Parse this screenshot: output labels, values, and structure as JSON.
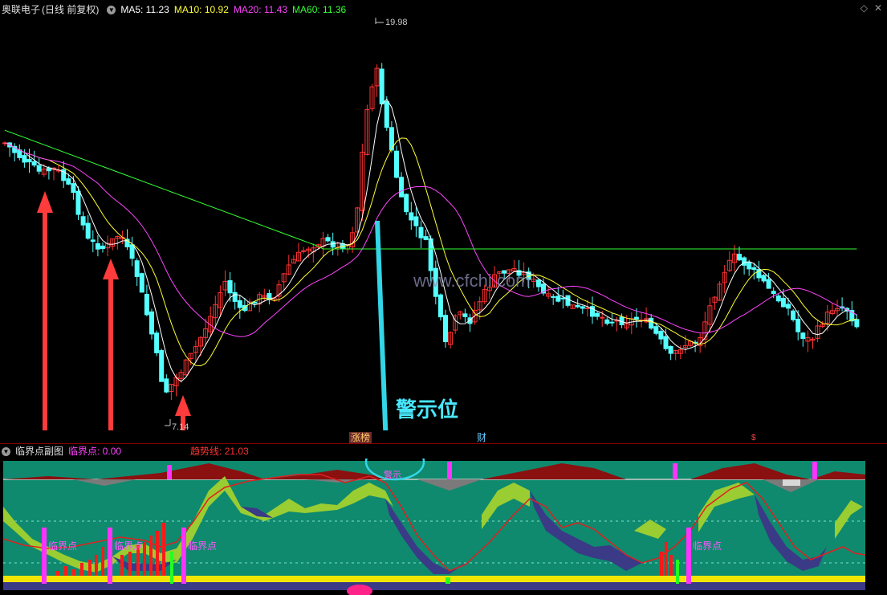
{
  "main_panel": {
    "stock_name": "奥联电子",
    "period_label": "(日线 前复权)",
    "indicators": [
      {
        "label": "MA5: 11.23",
        "color": "#ffffff"
      },
      {
        "label": "MA10: 10.92",
        "color": "#ffff33"
      },
      {
        "label": "MA20: 11.43",
        "color": "#ff44ff"
      },
      {
        "label": "MA60: 11.36",
        "color": "#33ff33"
      }
    ],
    "high_label": "19.98",
    "low_label": "7.14",
    "watermark": "www.cfchi.com",
    "annotation": "警示位",
    "top_right_icons": [
      "diamond-icon",
      "close-icon"
    ],
    "event_markers": {
      "limit_up": "涨榜",
      "finance": "财",
      "s": "$"
    }
  },
  "sub_panel": {
    "title": "临界点副图",
    "indicators": [
      {
        "label": "临界点: 0.00",
        "color": "#ff44ff"
      },
      {
        "label": "趋势线: 21.03",
        "color": "#ff3333"
      }
    ],
    "critical_label": "临界点",
    "warn_label": "警示"
  },
  "colors": {
    "up": "#ff3232",
    "down": "#54ffff",
    "ma5": "#ffffff",
    "ma10": "#ffff33",
    "ma20": "#ff44ff",
    "ma60": "#33ff33",
    "sub_bg": "#0f8a6e",
    "arrow_red": "#ff3b3b",
    "arrow_cyan": "#33d6e6"
  }
}
